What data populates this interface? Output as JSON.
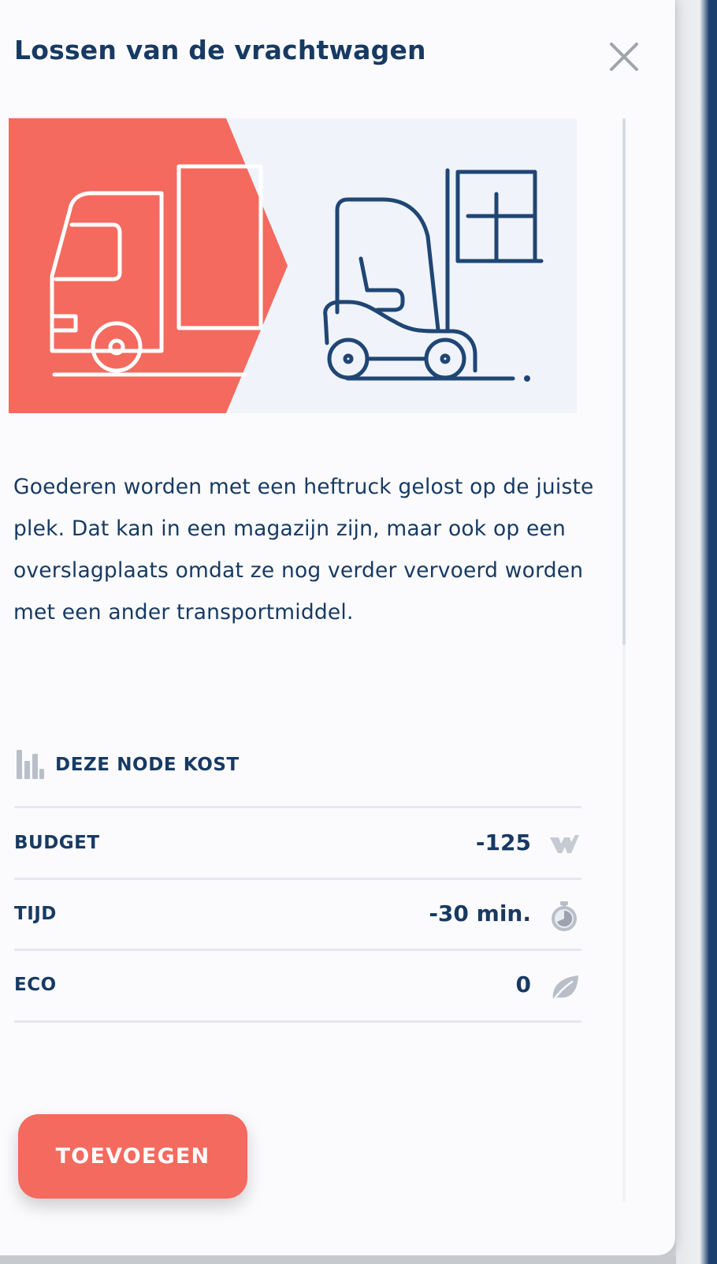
{
  "panel": {
    "title": "Lossen van de vrachtwagen",
    "description": "Goederen worden met een heftruck gelost op de juiste plek. Dat kan in een magazijn zijn, maar ook op een overslagplaats omdat ze nog verder vervoerd worden met een ander transportmiddel.",
    "hero_icons": [
      "truck-icon",
      "forklift-icon"
    ],
    "close_icon": "close-icon"
  },
  "costs": {
    "header_icon": "bar-chart-icon",
    "header": "DEZE NODE KOST",
    "rows": [
      {
        "label": "BUDGET",
        "value": "-125",
        "icon": "budget-icon"
      },
      {
        "label": "TIJD",
        "value": "-30 min.",
        "icon": "stopwatch-icon"
      },
      {
        "label": "ECO",
        "value": "0",
        "icon": "leaf-icon"
      }
    ]
  },
  "actions": {
    "add_label": "TOEVOEGEN"
  },
  "colors": {
    "primary_text": "#173a63",
    "accent": "#f46a5e",
    "icon_gray": "#b9bfc9",
    "hero_bg": "#f0f3fa",
    "forklift_stroke": "#1f4674"
  }
}
